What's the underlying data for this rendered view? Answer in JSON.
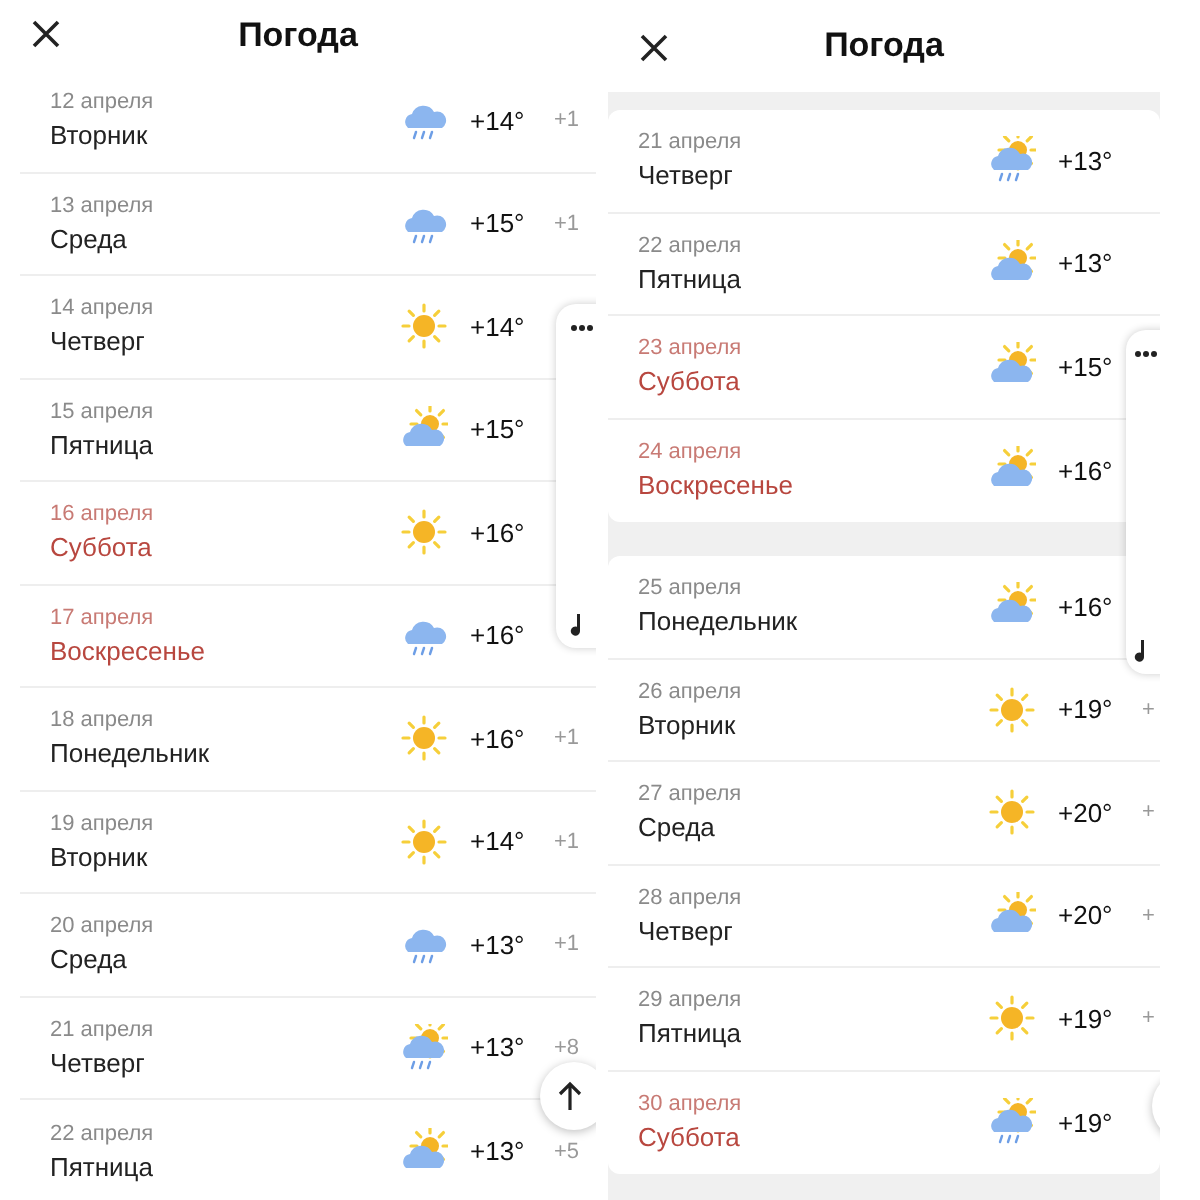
{
  "panels": [
    {
      "title": "Погода",
      "groups": [
        {
          "days": [
            {
              "date": "12 апреля",
              "weekday": "Вторник",
              "weekend": false,
              "kind": "rain",
              "day": "+14°",
              "night": "+1"
            },
            {
              "date": "13 апреля",
              "weekday": "Среда",
              "weekend": false,
              "kind": "rain",
              "day": "+15°",
              "night": "+1"
            },
            {
              "date": "14 апреля",
              "weekday": "Четверг",
              "weekend": false,
              "kind": "sun",
              "day": "+14°"
            },
            {
              "date": "15 апреля",
              "weekday": "Пятница",
              "weekend": false,
              "kind": "partly",
              "day": "+15°"
            },
            {
              "date": "16 апреля",
              "weekday": "Суббота",
              "weekend": true,
              "kind": "sun",
              "day": "+16°"
            },
            {
              "date": "17 апреля",
              "weekday": "Воскресенье",
              "weekend": true,
              "kind": "rain",
              "day": "+16°"
            },
            {
              "date": "18 апреля",
              "weekday": "Понедельник",
              "weekend": false,
              "kind": "sun",
              "day": "+16°",
              "night": "+1"
            },
            {
              "date": "19 апреля",
              "weekday": "Вторник",
              "weekend": false,
              "kind": "sun",
              "day": "+14°",
              "night": "+1"
            },
            {
              "date": "20 апреля",
              "weekday": "Среда",
              "weekend": false,
              "kind": "rain",
              "day": "+13°",
              "night": "+1"
            },
            {
              "date": "21 апреля",
              "weekday": "Четверг",
              "weekend": false,
              "kind": "partly-rain",
              "day": "+13°",
              "night": "+8"
            },
            {
              "date": "22 апреля",
              "weekday": "Пятница",
              "weekend": false,
              "kind": "partly",
              "day": "+13°",
              "night": "+5"
            }
          ]
        }
      ]
    },
    {
      "title": "Погода",
      "groups": [
        {
          "days": [
            {
              "date": "21 апреля",
              "weekday": "Четверг",
              "weekend": false,
              "kind": "partly-rain",
              "day": "+13°"
            },
            {
              "date": "22 апреля",
              "weekday": "Пятница",
              "weekend": false,
              "kind": "partly",
              "day": "+13°"
            },
            {
              "date": "23 апреля",
              "weekday": "Суббота",
              "weekend": true,
              "kind": "partly",
              "day": "+15°"
            },
            {
              "date": "24 апреля",
              "weekday": "Воскресенье",
              "weekend": true,
              "kind": "partly",
              "day": "+16°"
            }
          ]
        },
        {
          "days": [
            {
              "date": "25 апреля",
              "weekday": "Понедельник",
              "weekend": false,
              "kind": "partly",
              "day": "+16°"
            },
            {
              "date": "26 апреля",
              "weekday": "Вторник",
              "weekend": false,
              "kind": "sun",
              "day": "+19°",
              "night": "+"
            },
            {
              "date": "27 апреля",
              "weekday": "Среда",
              "weekend": false,
              "kind": "sun",
              "day": "+20°",
              "night": "+"
            },
            {
              "date": "28 апреля",
              "weekday": "Четверг",
              "weekend": false,
              "kind": "partly",
              "day": "+20°",
              "night": "+"
            },
            {
              "date": "29 апреля",
              "weekday": "Пятница",
              "weekend": false,
              "kind": "sun",
              "day": "+19°",
              "night": "+"
            },
            {
              "date": "30 апреля",
              "weekday": "Суббота",
              "weekend": true,
              "kind": "partly-rain",
              "day": "+19°"
            }
          ]
        }
      ]
    }
  ]
}
